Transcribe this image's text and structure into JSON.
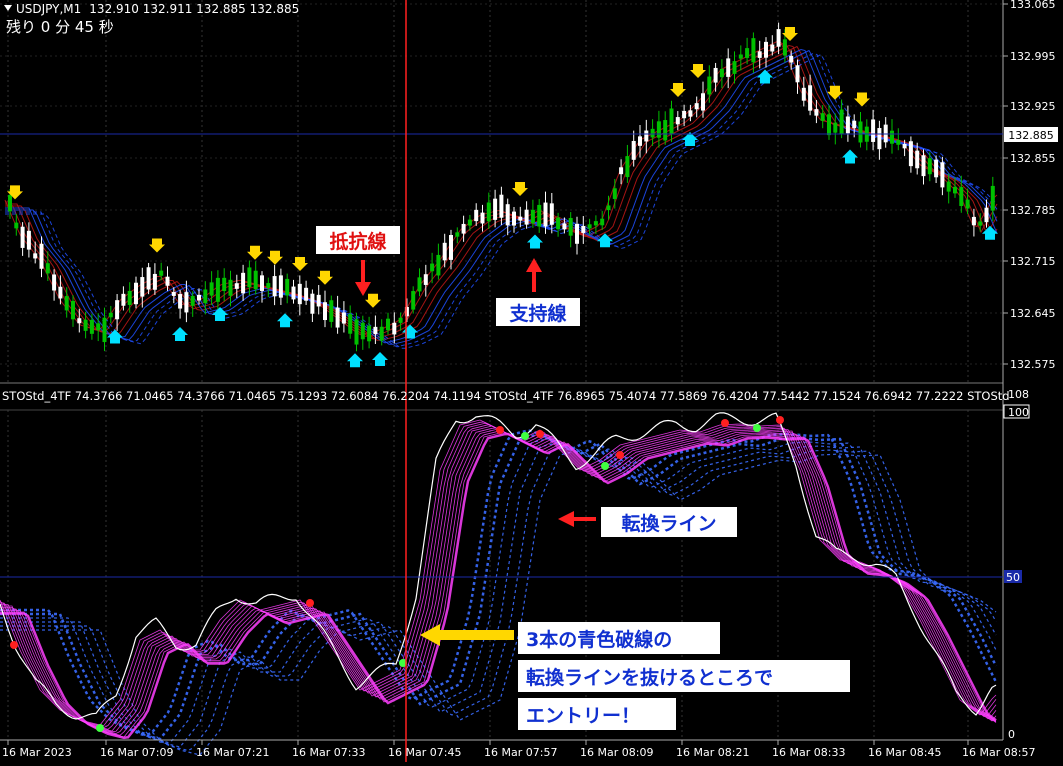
{
  "header": {
    "symbol": "USDJPY,M1",
    "ohlc": "132.910 132.911 132.885 132.885",
    "timer": "残り 0 分 45 秒"
  },
  "price_axis": {
    "ticks": [
      "133.065",
      "132.995",
      "132.925",
      "132.855",
      "132.785",
      "132.715",
      "132.645",
      "132.575"
    ],
    "current": "132.885"
  },
  "indicator": {
    "label": "STOStd_4TF 74.3766 71.0465 74.3766 71.0465 75.1293 72.6084 76.2204 74.1194  STOStd_4TF 76.8965 75.4074 77.5869 76.4204 77.5442 77.1524 76.6942 77.2222  STOStd",
    "axis_top": "108",
    "axis_100": "100",
    "axis_50": "50",
    "axis_0": "0"
  },
  "time_axis": [
    "16 Mar 2023",
    "16 Mar 07:09",
    "16 Mar 07:21",
    "16 Mar 07:33",
    "16 Mar 07:45",
    "16 Mar 07:57",
    "16 Mar 08:09",
    "16 Mar 08:21",
    "16 Mar 08:33",
    "16 Mar 08:45",
    "16 Mar 08:57"
  ],
  "annotations": {
    "resistance": "抵抗線",
    "support": "支持線",
    "switch_line": "転換ライン",
    "entry_line1": "3本の青色破線の",
    "entry_line2": "転換ラインを抜けるところで",
    "entry_line3": "エントリー！"
  },
  "colors": {
    "bull": "#00c000",
    "bear": "#ffffff",
    "resist": "#ff2020",
    "support_blue": "#3a6bff",
    "sto_magenta": "#ff40ff",
    "vline": "#ff2020",
    "arrow_yellow": "#ffd700",
    "arrow_cyan": "#00e0ff"
  }
}
